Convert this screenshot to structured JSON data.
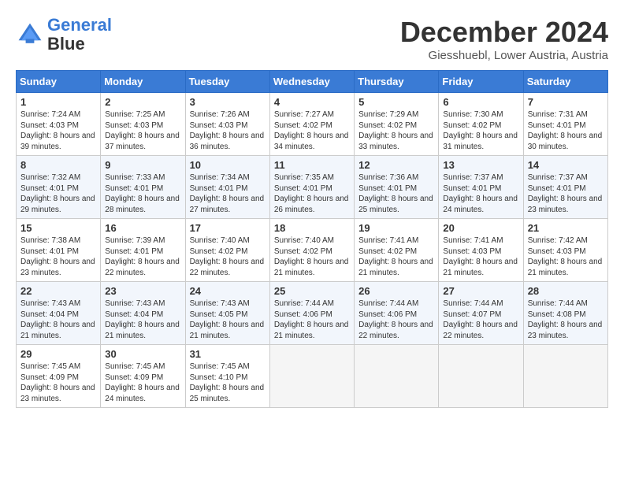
{
  "logo": {
    "line1": "General",
    "line2": "Blue"
  },
  "title": "December 2024",
  "location": "Giesshuebl, Lower Austria, Austria",
  "days_of_week": [
    "Sunday",
    "Monday",
    "Tuesday",
    "Wednesday",
    "Thursday",
    "Friday",
    "Saturday"
  ],
  "weeks": [
    [
      {
        "day": "1",
        "sunrise": "7:24 AM",
        "sunset": "4:03 PM",
        "daylight": "8 hours and 39 minutes."
      },
      {
        "day": "2",
        "sunrise": "7:25 AM",
        "sunset": "4:03 PM",
        "daylight": "8 hours and 37 minutes."
      },
      {
        "day": "3",
        "sunrise": "7:26 AM",
        "sunset": "4:03 PM",
        "daylight": "8 hours and 36 minutes."
      },
      {
        "day": "4",
        "sunrise": "7:27 AM",
        "sunset": "4:02 PM",
        "daylight": "8 hours and 34 minutes."
      },
      {
        "day": "5",
        "sunrise": "7:29 AM",
        "sunset": "4:02 PM",
        "daylight": "8 hours and 33 minutes."
      },
      {
        "day": "6",
        "sunrise": "7:30 AM",
        "sunset": "4:02 PM",
        "daylight": "8 hours and 31 minutes."
      },
      {
        "day": "7",
        "sunrise": "7:31 AM",
        "sunset": "4:01 PM",
        "daylight": "8 hours and 30 minutes."
      }
    ],
    [
      {
        "day": "8",
        "sunrise": "7:32 AM",
        "sunset": "4:01 PM",
        "daylight": "8 hours and 29 minutes."
      },
      {
        "day": "9",
        "sunrise": "7:33 AM",
        "sunset": "4:01 PM",
        "daylight": "8 hours and 28 minutes."
      },
      {
        "day": "10",
        "sunrise": "7:34 AM",
        "sunset": "4:01 PM",
        "daylight": "8 hours and 27 minutes."
      },
      {
        "day": "11",
        "sunrise": "7:35 AM",
        "sunset": "4:01 PM",
        "daylight": "8 hours and 26 minutes."
      },
      {
        "day": "12",
        "sunrise": "7:36 AM",
        "sunset": "4:01 PM",
        "daylight": "8 hours and 25 minutes."
      },
      {
        "day": "13",
        "sunrise": "7:37 AM",
        "sunset": "4:01 PM",
        "daylight": "8 hours and 24 minutes."
      },
      {
        "day": "14",
        "sunrise": "7:37 AM",
        "sunset": "4:01 PM",
        "daylight": "8 hours and 23 minutes."
      }
    ],
    [
      {
        "day": "15",
        "sunrise": "7:38 AM",
        "sunset": "4:01 PM",
        "daylight": "8 hours and 23 minutes."
      },
      {
        "day": "16",
        "sunrise": "7:39 AM",
        "sunset": "4:01 PM",
        "daylight": "8 hours and 22 minutes."
      },
      {
        "day": "17",
        "sunrise": "7:40 AM",
        "sunset": "4:02 PM",
        "daylight": "8 hours and 22 minutes."
      },
      {
        "day": "18",
        "sunrise": "7:40 AM",
        "sunset": "4:02 PM",
        "daylight": "8 hours and 21 minutes."
      },
      {
        "day": "19",
        "sunrise": "7:41 AM",
        "sunset": "4:02 PM",
        "daylight": "8 hours and 21 minutes."
      },
      {
        "day": "20",
        "sunrise": "7:41 AM",
        "sunset": "4:03 PM",
        "daylight": "8 hours and 21 minutes."
      },
      {
        "day": "21",
        "sunrise": "7:42 AM",
        "sunset": "4:03 PM",
        "daylight": "8 hours and 21 minutes."
      }
    ],
    [
      {
        "day": "22",
        "sunrise": "7:43 AM",
        "sunset": "4:04 PM",
        "daylight": "8 hours and 21 minutes."
      },
      {
        "day": "23",
        "sunrise": "7:43 AM",
        "sunset": "4:04 PM",
        "daylight": "8 hours and 21 minutes."
      },
      {
        "day": "24",
        "sunrise": "7:43 AM",
        "sunset": "4:05 PM",
        "daylight": "8 hours and 21 minutes."
      },
      {
        "day": "25",
        "sunrise": "7:44 AM",
        "sunset": "4:06 PM",
        "daylight": "8 hours and 21 minutes."
      },
      {
        "day": "26",
        "sunrise": "7:44 AM",
        "sunset": "4:06 PM",
        "daylight": "8 hours and 22 minutes."
      },
      {
        "day": "27",
        "sunrise": "7:44 AM",
        "sunset": "4:07 PM",
        "daylight": "8 hours and 22 minutes."
      },
      {
        "day": "28",
        "sunrise": "7:44 AM",
        "sunset": "4:08 PM",
        "daylight": "8 hours and 23 minutes."
      }
    ],
    [
      {
        "day": "29",
        "sunrise": "7:45 AM",
        "sunset": "4:09 PM",
        "daylight": "8 hours and 23 minutes."
      },
      {
        "day": "30",
        "sunrise": "7:45 AM",
        "sunset": "4:09 PM",
        "daylight": "8 hours and 24 minutes."
      },
      {
        "day": "31",
        "sunrise": "7:45 AM",
        "sunset": "4:10 PM",
        "daylight": "8 hours and 25 minutes."
      },
      null,
      null,
      null,
      null
    ]
  ]
}
